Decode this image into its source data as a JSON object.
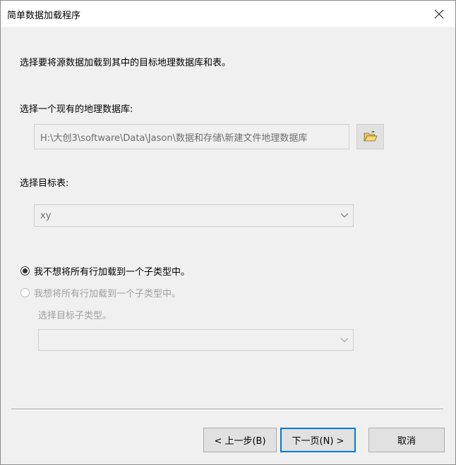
{
  "window": {
    "title": "简单数据加载程序"
  },
  "page": {
    "instruction": "选择要将源数据加载到其中的目标地理数据库和表。",
    "db_label": "选择一个现有的地理数据库:",
    "db_path": "H:\\大创3\\software\\Data\\Jason\\数据和存储\\新建文件地理数据库",
    "table_label": "选择目标表:",
    "table_value": "xy",
    "radio_no_subtype": "我不想将所有行加载到一个子类型中。",
    "radio_subtype": "我想将所有行加载到一个子类型中。",
    "subtype_label": "选择目标子类型。",
    "subtype_value": ""
  },
  "buttons": {
    "back": "< 上一步(B)",
    "next": "下一页(N) >",
    "cancel": "取消"
  },
  "icons": {
    "close": "close-icon",
    "browse": "folder-open-icon",
    "dropdown": "chevron-down-icon"
  }
}
